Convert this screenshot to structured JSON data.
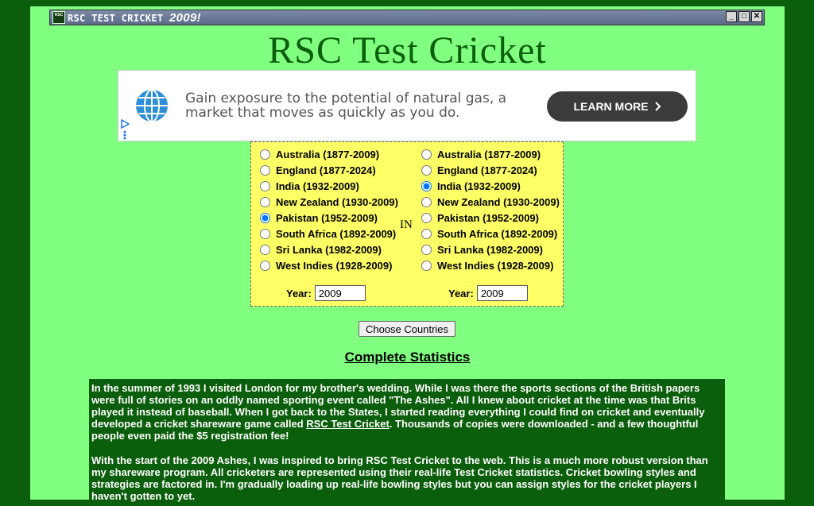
{
  "window": {
    "title": "RSC TEST CRICKET",
    "title_year": "2009!",
    "icon_text": "RSC",
    "min": "_",
    "max": "□",
    "close": "✕"
  },
  "heading": "RSC Test Cricket",
  "ad": {
    "text": "Gain exposure to the potential of natural gas, a market that moves as quickly as you do.",
    "button": "LEARN MORE"
  },
  "countries": {
    "left": [
      {
        "label": "Australia (1877-2009)",
        "checked": false
      },
      {
        "label": "England (1877-2024)",
        "checked": false
      },
      {
        "label": "India (1932-2009)",
        "checked": false
      },
      {
        "label": "New Zealand (1930-2009)",
        "checked": false
      },
      {
        "label": "Pakistan (1952-2009)",
        "checked": true
      },
      {
        "label": "South Africa (1892-2009)",
        "checked": false
      },
      {
        "label": "Sri Lanka (1982-2009)",
        "checked": false
      },
      {
        "label": "West Indies (1928-2009)",
        "checked": false
      }
    ],
    "right": [
      {
        "label": "Australia (1877-2009)",
        "checked": false
      },
      {
        "label": "England (1877-2024)",
        "checked": false
      },
      {
        "label": "India (1932-2009)",
        "checked": true
      },
      {
        "label": "New Zealand (1930-2009)",
        "checked": false
      },
      {
        "label": "Pakistan (1952-2009)",
        "checked": false
      },
      {
        "label": "South Africa (1892-2009)",
        "checked": false
      },
      {
        "label": "Sri Lanka (1982-2009)",
        "checked": false
      },
      {
        "label": "West Indies (1928-2009)",
        "checked": false
      }
    ],
    "in_label": "IN",
    "year_label": "Year:",
    "left_year": "2009",
    "right_year": "2009"
  },
  "choose_button": "Choose Countries",
  "stats_link": "Complete Statistics",
  "story": {
    "p1_a": "In the summer of 1993 I visited London for my brother's wedding. While I was there the sports sections of the British papers were full of stories on an oddly named sporting event called \"The Ashes\". All I knew about cricket at the time was that Brits played it instead of baseball. When I got back to the States, I started reading everything I could find on cricket and eventually developed a cricket shareware game called ",
    "p1_link": "RSC Test Cricket",
    "p1_b": ". Thousands of copies were downloaded - and a few thoughtful people even paid the $5 registration fee!",
    "p2": "With the start of the 2009 Ashes, I was inspired to bring RSC Test Cricket to the web. This is a much more robust version than my shareware program. All cricketers are represented using their real-life Test Cricket statistics. Cricket bowling styles and strategies are factored in. I'm gradually loading up real-life bowling styles but you can assign styles for the cricket players I haven't gotten to yet."
  }
}
